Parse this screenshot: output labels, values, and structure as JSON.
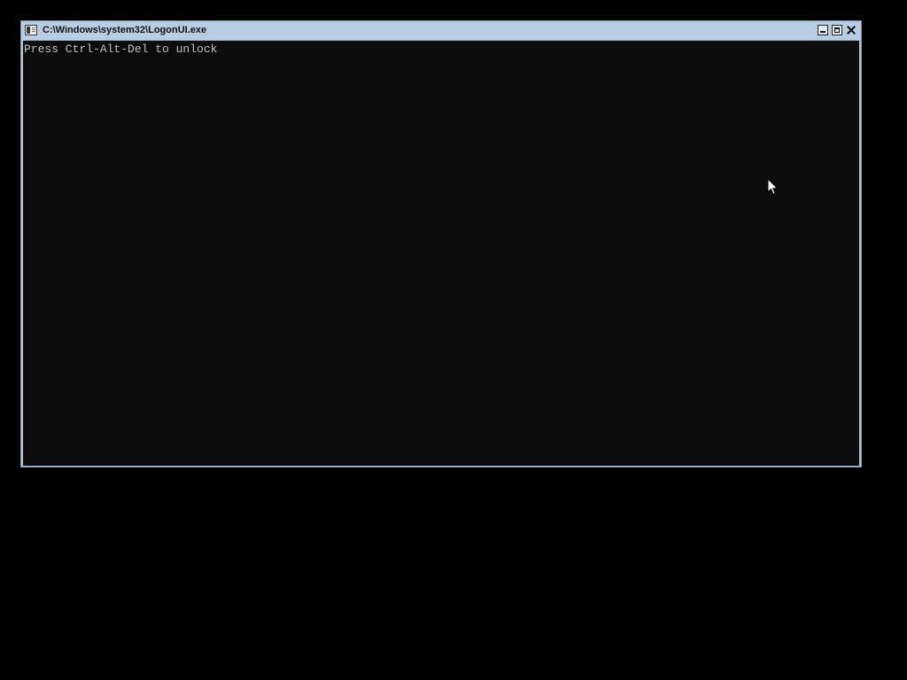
{
  "window": {
    "title": "C:\\Windows\\system32\\LogonUI.exe",
    "icon": "console-app-icon",
    "controls": {
      "minimize_icon": "minimize-icon",
      "maximize_icon": "maximize-icon",
      "close_icon": "close-icon"
    },
    "colors": {
      "titlebar": "#b9cde2",
      "console_background": "#0c0c0c",
      "console_text": "#c0c0c0",
      "desktop": "#000000"
    }
  },
  "console": {
    "lines": [
      "Press Ctrl-Alt-Del to unlock"
    ]
  },
  "pointer": {
    "icon": "mouse-pointer-icon"
  }
}
